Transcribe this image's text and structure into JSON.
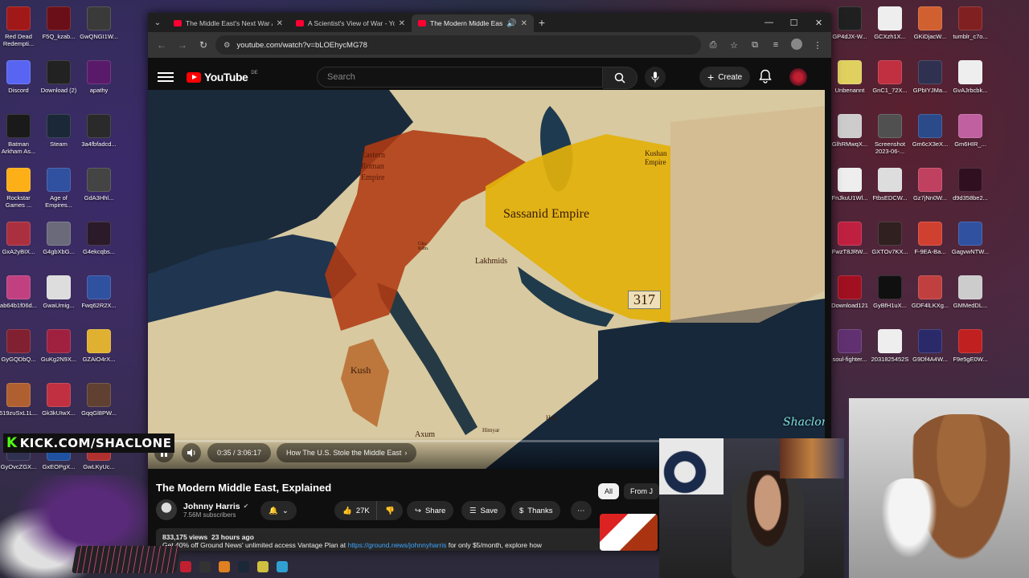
{
  "desktop": {
    "left_icons": [
      {
        "label": "Red Dead Redempti...",
        "color": "#a01818"
      },
      {
        "label": "F5Q_kzab...",
        "color": "#6a0f18"
      },
      {
        "label": "GwQNGI1W...",
        "color": "#3a3a3a"
      },
      {
        "label": "Discord",
        "color": "#5865f2"
      },
      {
        "label": "Download (2)",
        "color": "#222"
      },
      {
        "label": "apathy",
        "color": "#5a1a6a"
      },
      {
        "label": "Batman Arkham As...",
        "color": "#1a1a1a"
      },
      {
        "label": "Steam",
        "color": "#1b2838"
      },
      {
        "label": "3a4fbfadcd...",
        "color": "#2a2a2a"
      },
      {
        "label": "Rockstar Games ...",
        "color": "#fcaf17"
      },
      {
        "label": "Age of Empires...",
        "color": "#3050a0"
      },
      {
        "label": "GdA3Hhl...",
        "color": "#444"
      },
      {
        "label": "GxA2yBIX...",
        "color": "#aa3040"
      },
      {
        "label": "G4gbXbG...",
        "color": "#6a6a7a"
      },
      {
        "label": "G4ekcqbs...",
        "color": "#2a1a2a"
      },
      {
        "label": "ab64b1f06d...",
        "color": "#c04080"
      },
      {
        "label": "GwaUmig...",
        "color": "#ddd"
      },
      {
        "label": "Fwq62R2X...",
        "color": "#3050a0"
      },
      {
        "label": "GyGQDbQ...",
        "color": "#802030"
      },
      {
        "label": "GuKg2N9X...",
        "color": "#a02040"
      },
      {
        "label": "GZAiO4rX...",
        "color": "#e0b030"
      },
      {
        "label": "619zuSxL1L...",
        "color": "#b06030"
      },
      {
        "label": "Gk3kUIwX...",
        "color": "#c03040"
      },
      {
        "label": "GqqGl8PW...",
        "color": "#604030"
      },
      {
        "label": "GyOvcZGX...",
        "color": "#303050"
      },
      {
        "label": "GxEOPgX...",
        "color": "#2050a0"
      },
      {
        "label": "GwLKyUc...",
        "color": "#b03030"
      }
    ],
    "right_icons": [
      {
        "label": "GP4dJX-W...",
        "color": "#202020"
      },
      {
        "label": "GCXzh1X...",
        "color": "#eee"
      },
      {
        "label": "GKiDjacW...",
        "color": "#d06030"
      },
      {
        "label": "tumblr_c7o...",
        "color": "#802020"
      },
      {
        "label": "Unbenannt",
        "color": "#e0d060"
      },
      {
        "label": "GnC1_72X...",
        "color": "#c03040"
      },
      {
        "label": "GPbIYJMa...",
        "color": "#303050"
      },
      {
        "label": "GvAJrbcbk...",
        "color": "#eee"
      },
      {
        "label": "GlhRMwqX...",
        "color": "#ccc"
      },
      {
        "label": "Screenshot 2023-06-...",
        "color": "#505050"
      },
      {
        "label": "Gm6cX3eX...",
        "color": "#2a4a8a"
      },
      {
        "label": "Gm6HIR_...",
        "color": "#c060a0"
      },
      {
        "label": "FnJkuU1Wl...",
        "color": "#eee"
      },
      {
        "label": "FtbsEDCW...",
        "color": "#ddd"
      },
      {
        "label": "Gz7jNn0W...",
        "color": "#c04060"
      },
      {
        "label": "d9d358be2...",
        "color": "#301020"
      },
      {
        "label": "FwzT8JRW...",
        "color": "#c02040"
      },
      {
        "label": "GXTOv7KX...",
        "color": "#302020"
      },
      {
        "label": "F-9EA-Ba...",
        "color": "#d04030"
      },
      {
        "label": "GagvwNTW...",
        "color": "#3050a0"
      },
      {
        "label": "Download121",
        "color": "#a01020"
      },
      {
        "label": "GyBfH1uX...",
        "color": "#101010"
      },
      {
        "label": "GDF4lLKXg...",
        "color": "#c04040"
      },
      {
        "label": "GMMedDL...",
        "color": "#ccc"
      },
      {
        "label": "soul-fighter...",
        "color": "#603070"
      },
      {
        "label": "2031825452S",
        "color": "#eee"
      },
      {
        "label": "G9Df4A4W...",
        "color": "#2a2a6a"
      },
      {
        "label": "F9e5gE0W...",
        "color": "#c02020"
      }
    ]
  },
  "browser": {
    "tabs": [
      {
        "title": "The Middle East's Next War Aft",
        "active": false
      },
      {
        "title": "A Scientist's View of War - You",
        "active": false
      },
      {
        "title": "The Modern Middle East, E",
        "active": true
      }
    ],
    "url": "youtube.com/watch?v=bLOEhycMG78"
  },
  "youtube": {
    "logo_text": "YouTube",
    "country": "DE",
    "search_placeholder": "Search",
    "create_label": "Create",
    "video": {
      "current_time": "0:35",
      "duration": "3:06:17",
      "time_display": "0:35 / 3:06:17",
      "progress_fraction": 0.0031,
      "chapter": "How The U.S. Stole the Middle East",
      "map_labels": {
        "eastern_roman": "Eastern Roman Empire",
        "sassanid": "Sassanid Empire",
        "kushan": "Kushan Empire",
        "year": "317",
        "lakhmids": "Lakhmids",
        "ghassanids": "Gha. Kdm.",
        "kush": "Kush",
        "aksum": "Axum",
        "himyar": "Himyar",
        "had": "Had."
      },
      "watermark": "Shaclone"
    },
    "title": "The Modern Middle East, Explained",
    "channel": {
      "name": "Johnny Harris",
      "subs": "7.56M subscribers"
    },
    "actions": {
      "likes": "27K",
      "share": "Share",
      "save": "Save",
      "thanks": "Thanks"
    },
    "meta": {
      "views": "833,175 views",
      "age": "23 hours ago",
      "desc_prefix": "Get 40% off Ground News' unlimited access Vantage Plan at",
      "desc_link": "https://ground.news/johnnyharris",
      "desc_suffix": "for only $5/month, explore how"
    },
    "chips": [
      "All",
      "From J"
    ]
  },
  "overlays": {
    "kick_text": "KICK.COM/SHACLONE"
  }
}
